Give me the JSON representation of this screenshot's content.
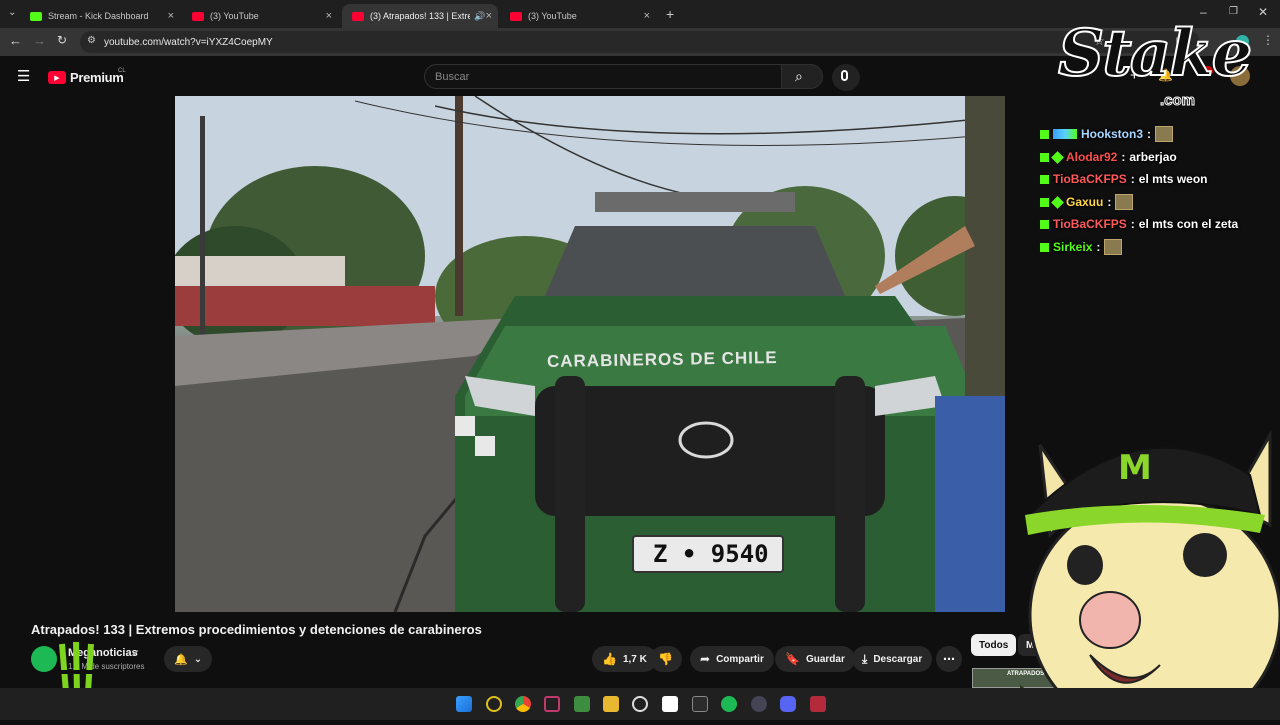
{
  "browser": {
    "tabs": [
      {
        "label": "Stream - Kick Dashboard",
        "color": "#53fc18"
      },
      {
        "label": "(3) YouTube",
        "color": "#ff0033"
      },
      {
        "label": "(3) Atrapados! 133 | Extrem",
        "color": "#ff0033"
      },
      {
        "label": "(3) YouTube",
        "color": "#ff0033"
      }
    ],
    "url": "youtube.com/watch?v=iYXZ4CoepMY"
  },
  "youtube": {
    "logo_text": "Premium",
    "logo_region": "CL",
    "search_placeholder": "Buscar",
    "video_title": "Atrapados! 133 | Extremos procedimientos y detenciones de carabineros",
    "channel_name": "Meganoticias",
    "subscribers": "1,7 M de suscriptores",
    "like_count": "1,7 K",
    "share_label": "Compartir",
    "save_label": "Guardar",
    "download_label": "Descargar",
    "filter_all": "Todos",
    "filter_next": "M",
    "thumb_text": "ATRAPADOS!"
  },
  "video_scene": {
    "vehicle_text": "CARABINEROS DE CHILE",
    "plate": "Z • 9540"
  },
  "overlay": {
    "sponsor_main": "Stake",
    "sponsor_sub": ".com",
    "chat": [
      {
        "user": "Hookston3",
        "message": "",
        "color": "#a9d6ff",
        "emote": true
      },
      {
        "user": "Alodar92",
        "message": "arberjao",
        "color": "#ff4d4d",
        "emote": false
      },
      {
        "user": "TioBaCKFPS",
        "message": "el mts weon",
        "color": "#ff5a5a",
        "emote": false
      },
      {
        "user": "Gaxuu",
        "message": "",
        "color": "#ffd54a",
        "emote": true
      },
      {
        "user": "TioBaCKFPS",
        "message": "el mts con el zeta",
        "color": "#ff5a5a",
        "emote": false
      },
      {
        "user": "Sirkeix",
        "message": "",
        "color": "#53fc18",
        "emote": true
      }
    ]
  }
}
